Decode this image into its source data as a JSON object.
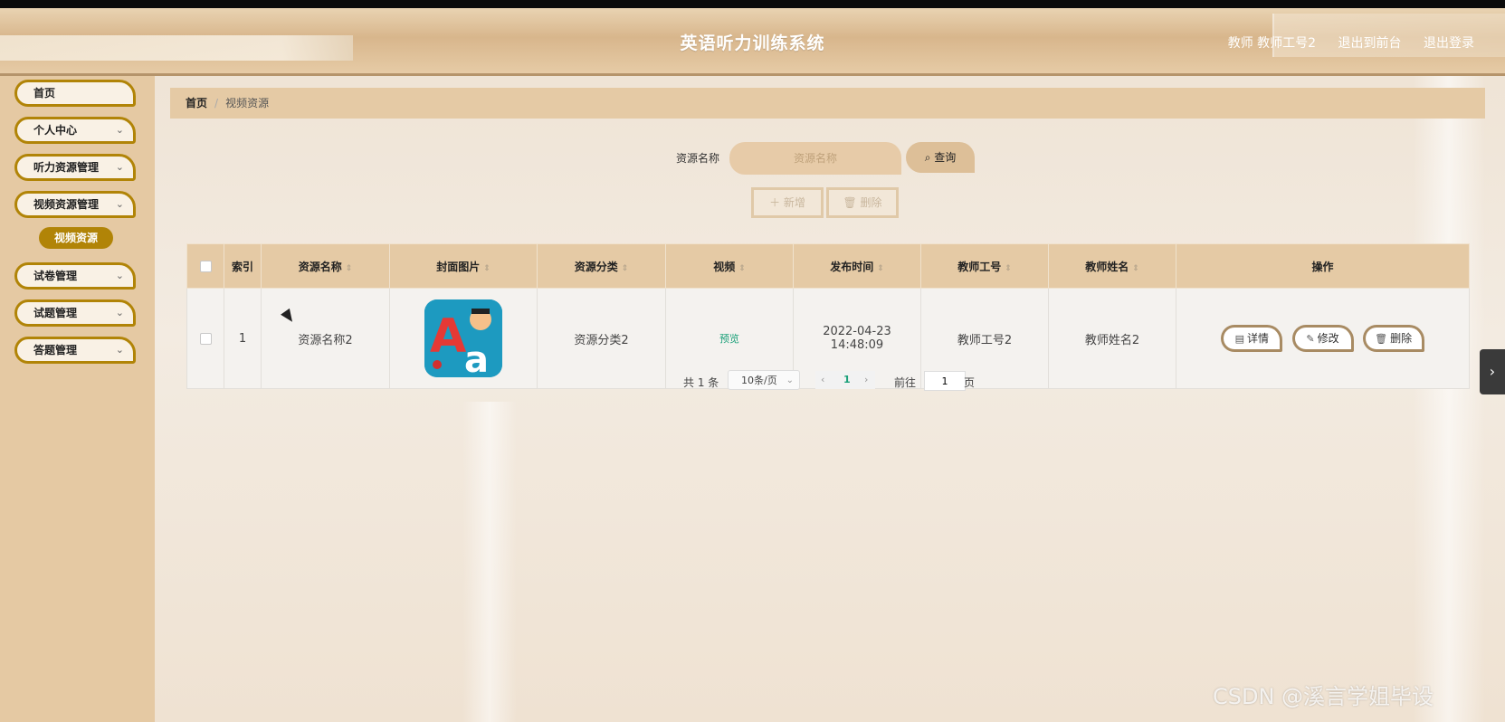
{
  "app": {
    "title": "英语听力训练系统"
  },
  "header": {
    "user_label": "教师 教师工号2",
    "front_label": "退出到前台",
    "logout_label": "退出登录"
  },
  "sidebar": {
    "items": [
      {
        "label": "首页",
        "has_children": false
      },
      {
        "label": "个人中心",
        "has_children": true
      },
      {
        "label": "听力资源管理",
        "has_children": true
      },
      {
        "label": "视频资源管理",
        "has_children": true,
        "sub": [
          "视频资源"
        ]
      },
      {
        "label": "试卷管理",
        "has_children": true
      },
      {
        "label": "试题管理",
        "has_children": true
      },
      {
        "label": "答题管理",
        "has_children": true
      }
    ]
  },
  "breadcrumb": {
    "home": "首页",
    "separator": "/",
    "current": "视频资源"
  },
  "search": {
    "label": "资源名称",
    "placeholder": "资源名称",
    "button": "查询"
  },
  "actions": {
    "add": "新增",
    "delete": "删除"
  },
  "table": {
    "columns": [
      "索引",
      "资源名称",
      "封面图片",
      "资源分类",
      "视频",
      "发布时间",
      "教师工号",
      "教师姓名",
      "操作"
    ],
    "rows": [
      {
        "index": "1",
        "name": "资源名称2",
        "cover": "alphabet-cover-image",
        "category": "资源分类2",
        "video": "预览",
        "time": "2022-04-23 14:48:09",
        "teacher_id": "教师工号2",
        "teacher_name": "教师姓名2",
        "ops": [
          "详情",
          "修改",
          "删除"
        ]
      }
    ]
  },
  "pagination": {
    "total": "共 1 条",
    "page_size": "10条/页",
    "current": "1",
    "goto_prefix": "前往",
    "goto_value": "1",
    "goto_suffix": "页"
  },
  "watermark": "CSDN @溪言学姐毕设",
  "colors": {
    "accent": "#b18407",
    "header": "#d8b68c",
    "sidebar": "#e5c9a3",
    "preview_link": "#1aa079"
  }
}
